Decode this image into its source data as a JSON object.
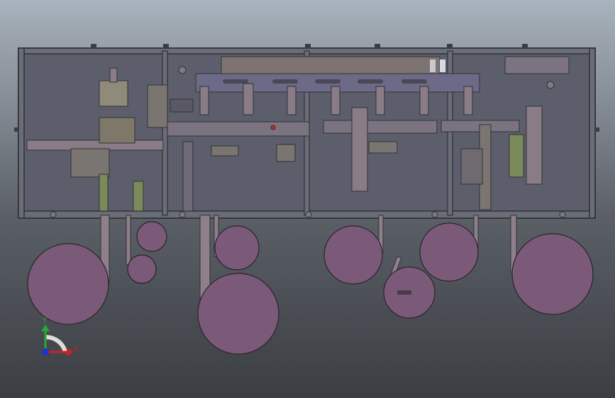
{
  "viewport": {
    "background_top": "#a9b3bd",
    "background_mid": "#5a5f66",
    "background_bottom": "#3b3e43",
    "frame_color": "#2f3236",
    "panel_fill": "#5c5f6b",
    "part_color": "#8a7c87",
    "disc_fill": "#7b5a79",
    "disc_stroke": "#2a2228",
    "beam_color": "#8e7f8b"
  },
  "triad": {
    "x_label": "X",
    "y_label": "Y",
    "x_color": "#cc2222",
    "y_color": "#22aa33",
    "z_color": "#2233cc"
  },
  "icons": [
    "triad-icon"
  ]
}
